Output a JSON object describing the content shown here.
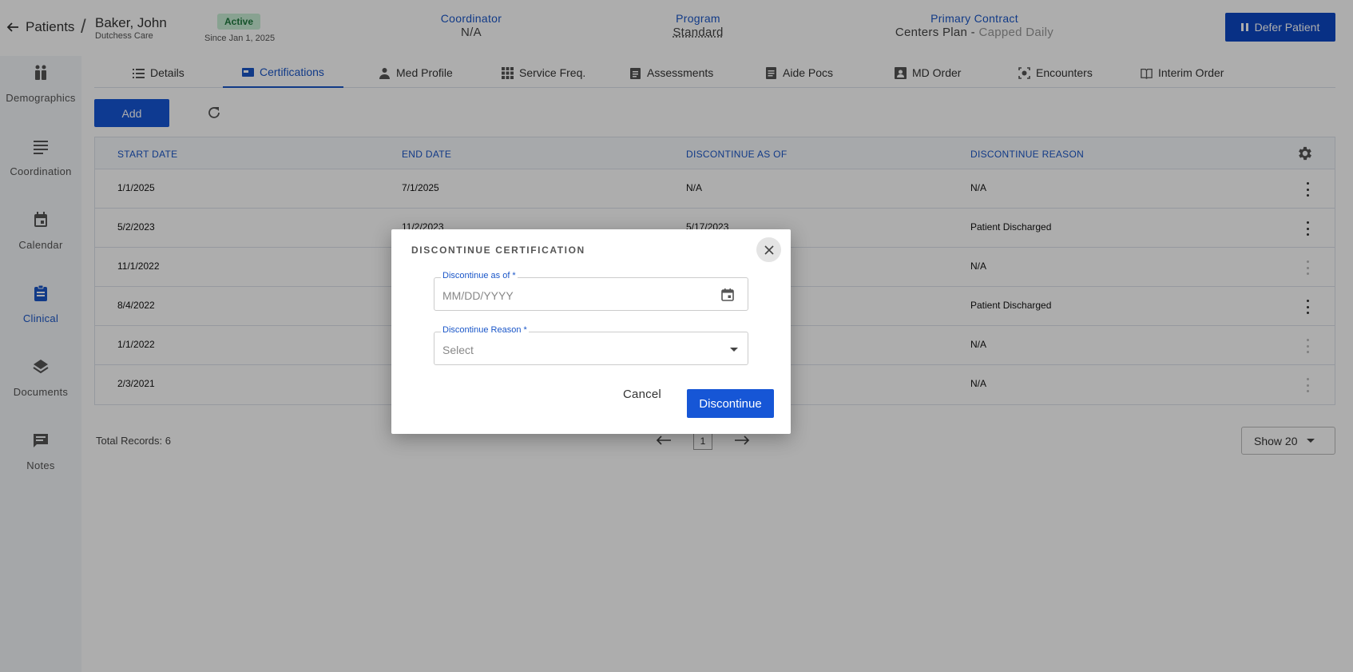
{
  "header": {
    "breadcrumb_root": "Patients",
    "breadcrumb_sep": "/",
    "patient_name": "Baker, John",
    "agency": "Dutchess Care",
    "status": "Active",
    "since": "Since Jan 1, 2025",
    "coordinator_label": "Coordinator",
    "coordinator_value": "N/A",
    "program_label": "Program",
    "program_value": "Standard",
    "contract_label": "Primary Contract",
    "contract_value": "Centers Plan - ",
    "contract_sub": "Capped Daily",
    "defer_label": "Defer Patient"
  },
  "sidebar": {
    "items": [
      {
        "label": "Demographics",
        "icon": "people-icon"
      },
      {
        "label": "Coordination",
        "icon": "lines-icon"
      },
      {
        "label": "Calendar",
        "icon": "calendar-icon"
      },
      {
        "label": "Clinical",
        "icon": "clipboard-icon",
        "active": true
      },
      {
        "label": "Documents",
        "icon": "layers-icon"
      },
      {
        "label": "Notes",
        "icon": "chat-icon"
      }
    ]
  },
  "tabs": [
    {
      "label": "Details"
    },
    {
      "label": "Certifications",
      "active": true
    },
    {
      "label": "Med Profile"
    },
    {
      "label": "Service Freq."
    },
    {
      "label": "Assessments"
    },
    {
      "label": "Aide Pocs"
    },
    {
      "label": "MD Order"
    },
    {
      "label": "Encounters"
    },
    {
      "label": "Interim Order"
    }
  ],
  "toolbar": {
    "add_label": "Add"
  },
  "table": {
    "columns": [
      "START DATE",
      "END DATE",
      "DISCONTINUE AS OF",
      "DISCONTINUE REASON"
    ],
    "rows": [
      {
        "start": "1/1/2025",
        "end": "7/1/2025",
        "as_of": "N/A",
        "reason": "N/A"
      },
      {
        "start": "5/2/2023",
        "end": "11/2/2023",
        "as_of": "5/17/2023",
        "reason": "Patient Discharged"
      },
      {
        "start": "11/1/2022",
        "end": "",
        "as_of": "",
        "reason": "N/A"
      },
      {
        "start": "8/4/2022",
        "end": "",
        "as_of": "",
        "reason": "Patient Discharged"
      },
      {
        "start": "1/1/2022",
        "end": "",
        "as_of": "",
        "reason": "N/A"
      },
      {
        "start": "2/3/2021",
        "end": "",
        "as_of": "",
        "reason": "N/A"
      }
    ]
  },
  "footer": {
    "total_label": "Total Records:",
    "total_value": "6",
    "page": "1",
    "show_label": "Show 20"
  },
  "modal": {
    "title": "DISCONTINUE CERTIFICATION",
    "as_of_label": "Discontinue as of *",
    "as_of_placeholder": "MM/DD/YYYY",
    "reason_label": "Discontinue Reason *",
    "reason_placeholder": "Select",
    "cancel_label": "Cancel",
    "confirm_label": "Discontinue"
  },
  "colors": {
    "accent": "#1a56c8",
    "primary_button": "#1656d6",
    "active_badge_bg": "#c9efd6"
  }
}
